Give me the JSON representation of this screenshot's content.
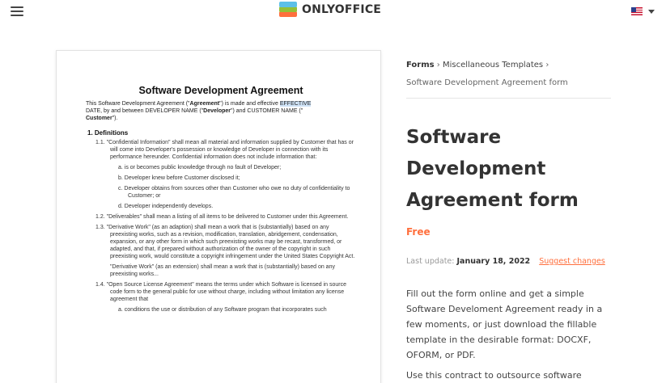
{
  "header": {
    "logo_text": "ONLYOFFICE",
    "menu_icon": "hamburger-menu-icon",
    "language_icon": "us-flag-icon"
  },
  "breadcrumb": {
    "item1": "Forms",
    "sep": "›",
    "item2": "Miscellaneous Templates",
    "item3": "Software Development Agreement form"
  },
  "product": {
    "title_line1": "Software",
    "title_line2": "Development",
    "title_line3": "Agreement form",
    "price": "Free",
    "last_update_label": "Last update:",
    "last_update_date": "January 18, 2022",
    "suggest_changes": "Suggest changes",
    "description_1": "Fill out the form online and get a simple Software Develoment Agreement ready in a few moments, or just download the fillable template in the desirable format: DOCXF, OFORM, or PDF.",
    "description_2": "Use this contract to outsource software"
  },
  "document": {
    "title": "Software Development Agreement",
    "intro_a": "This Software Development Agreement (\"",
    "intro_b": "Agreement",
    "intro_c": "\") is made and effective ",
    "intro_hl": "EFFECTIVE",
    "intro_d": "DATE, by and between DEVELOPER NAME (\"",
    "intro_e": "Developer",
    "intro_f": "\") and CUSTOMER NAME (\"",
    "intro_g": "Customer",
    "intro_h": "\").",
    "section1": "1.  Definitions",
    "c11": "1.1. \"Confidential Information\" shall mean all material and information supplied by Customer that has or will come into Developer's possession or knowledge of Developer in connection with its performance hereunder. Confidential information does not include information that:",
    "s_a": "a.  is or becomes public knowledge through no fault of Developer;",
    "s_b": "b.  Developer knew before Customer disclosed it;",
    "s_c": "c.  Developer obtains from sources other than Customer who owe no duty of confidentiality to Customer; or",
    "s_d": "d.  Developer independently develops.",
    "c12": "1.2. \"Deliverables\" shall mean a listing of all items to be delivered to Customer under this Agreement.",
    "c13": "1.3. \"Derivative Work\" (as an adaption) shall mean a work that is (substantially) based on any preexisting works, such as a revision, modification, translation, abridgement, condensation, expansion, or any other form in which such preexisting works may be recast, transformed, or adapted, and that, if prepared without authorization of the owner of the copyright in such preexisting work, would constitute a copyright infringement under the United States Copyright Act.",
    "c13b": "\"Derivative Work\" (as an extension) shall mean a work that is (substantially) based on any preexisting works...",
    "c14": "1.4. \"Open Source License Agreement\" means the terms under which Software is licensed in source code form to the general public for use without charge, including without limitation any license agreement that",
    "s14a": "a.  conditions the use or distribution of any Software program that incorporates such"
  }
}
